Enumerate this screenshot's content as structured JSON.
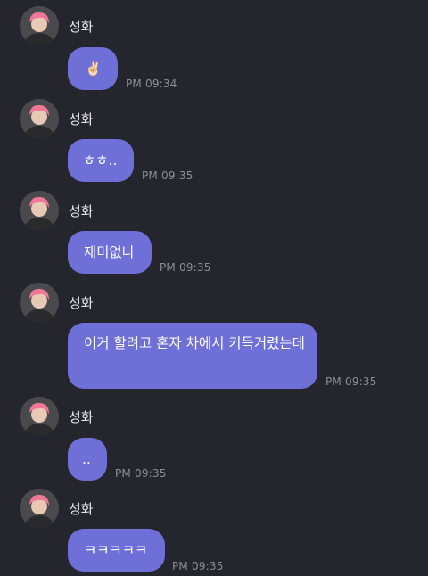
{
  "messages": [
    {
      "sender": "성화",
      "text": "✌🏻",
      "time": "PM 09:34"
    },
    {
      "sender": "성화",
      "text": "ㅎㅎ..",
      "time": "PM 09:35"
    },
    {
      "sender": "성화",
      "text": "재미없나",
      "time": "PM 09:35"
    },
    {
      "sender": "성화",
      "text": "이거 할려고 혼자 차에서 키득거렸는데",
      "time": "PM 09:35"
    },
    {
      "sender": "성화",
      "text": "..",
      "time": "PM 09:35"
    },
    {
      "sender": "성화",
      "text": "ㅋㅋㅋㅋㅋ",
      "time": "PM 09:35"
    }
  ],
  "colors": {
    "background": "#25252d",
    "bubble": "#6e6fd7",
    "bubble_text": "#ffffff",
    "sender_text": "#e9e9ee",
    "time_text": "#8d8d96"
  }
}
